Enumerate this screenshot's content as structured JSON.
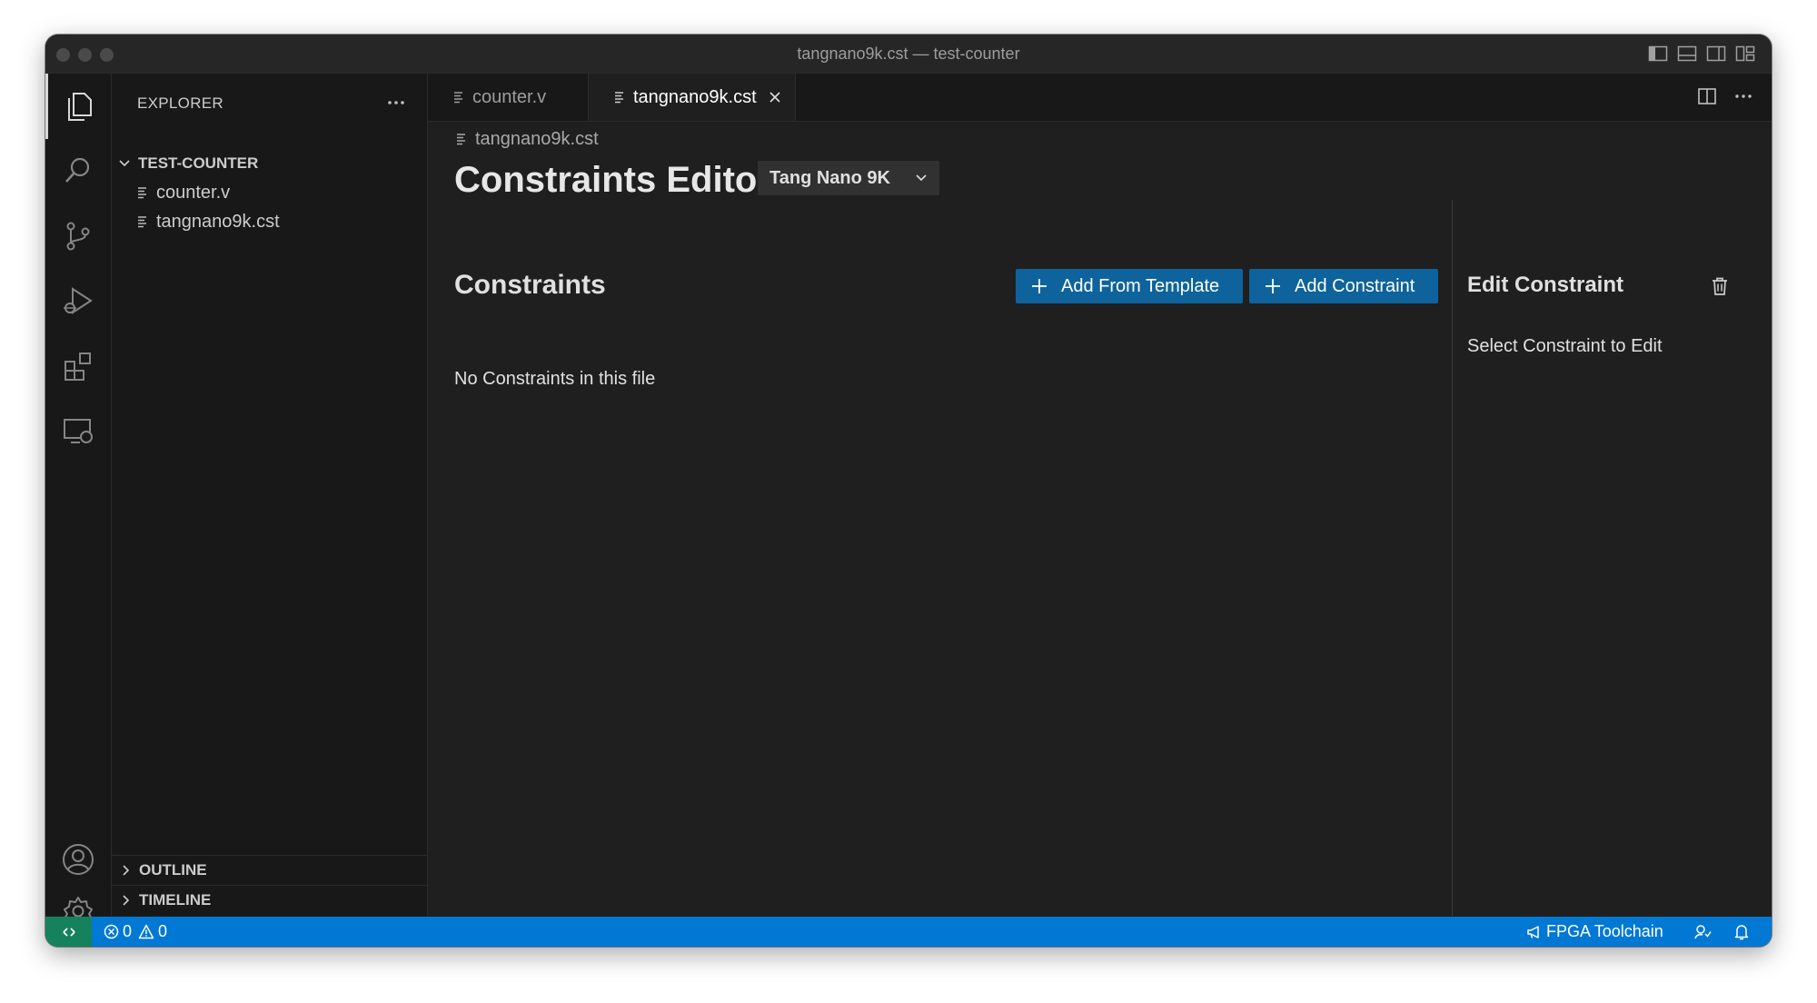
{
  "window": {
    "title": "tangnano9k.cst — test-counter"
  },
  "sidebar": {
    "header": "EXPLORER",
    "folder": "TEST-COUNTER",
    "files": [
      "counter.v",
      "tangnano9k.cst"
    ],
    "sections": [
      "OUTLINE",
      "TIMELINE"
    ]
  },
  "tabs": [
    {
      "label": "counter.v",
      "active": false
    },
    {
      "label": "tangnano9k.cst",
      "active": true
    }
  ],
  "editor": {
    "breadcrumb": "tangnano9k.cst",
    "title": "Constraints Editor",
    "board_select": "Tang Nano 9K",
    "constraints_heading": "Constraints",
    "add_from_template": "Add From Template",
    "add_constraint": "Add Constraint",
    "empty_message": "No Constraints in this file",
    "edit_heading": "Edit Constraint",
    "edit_hint": "Select Constraint to Edit"
  },
  "statusbar": {
    "errors": "0",
    "warnings": "0",
    "toolchain": "FPGA Toolchain"
  },
  "colors": {
    "accent": "#0078d4",
    "button": "#0e639c",
    "remote": "#16825d",
    "background": "#1f1f1f",
    "sidebar": "#181818"
  }
}
